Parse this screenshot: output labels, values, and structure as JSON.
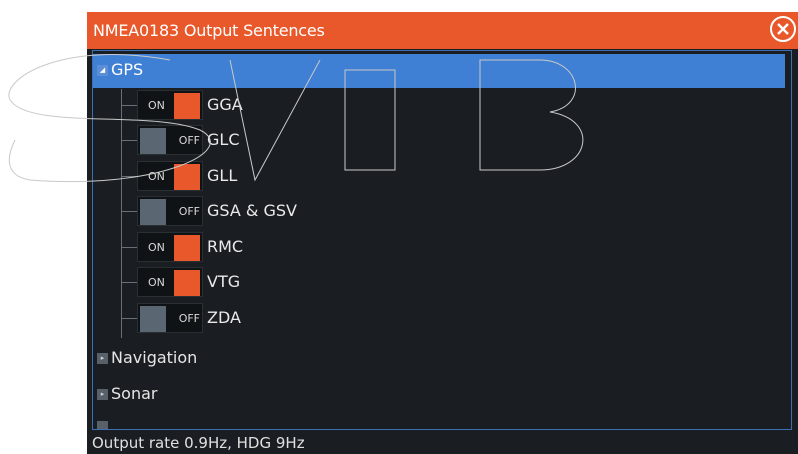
{
  "dialog": {
    "title": "NMEA0183 Output Sentences",
    "close_icon": "close-circle-icon",
    "accent_color": "#e8582a",
    "selection_color": "#3f7fd4"
  },
  "tree": {
    "categories": [
      {
        "label": "GPS",
        "expanded": true
      },
      {
        "label": "Navigation",
        "expanded": false
      },
      {
        "label": "Sonar",
        "expanded": false
      }
    ],
    "sentences": [
      {
        "name": "GGA",
        "state": "ON"
      },
      {
        "name": "GLC",
        "state": "OFF"
      },
      {
        "name": "GLL",
        "state": "ON"
      },
      {
        "name": "GSA & GSV",
        "state": "OFF"
      },
      {
        "name": "RMC",
        "state": "ON"
      },
      {
        "name": "VTG",
        "state": "ON"
      },
      {
        "name": "ZDA",
        "state": "OFF"
      }
    ]
  },
  "footer": {
    "status": "Output rate 0.9Hz, HDG 9Hz"
  }
}
